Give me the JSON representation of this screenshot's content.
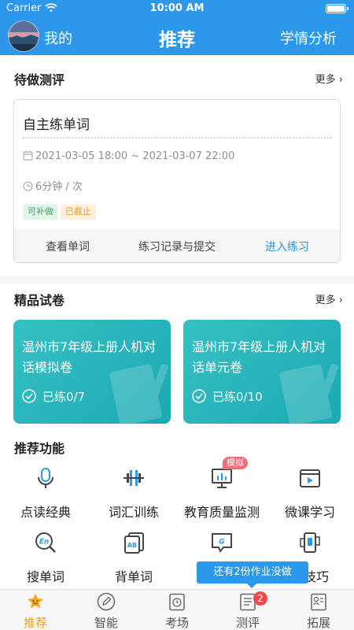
{
  "status_bar": {
    "carrier": "Carrier",
    "time": "10:00 AM"
  },
  "nav": {
    "mine": "我的",
    "title": "推荐",
    "analysis": "学情分析"
  },
  "pending": {
    "heading": "待做测评",
    "more": "更多",
    "card": {
      "title": "自主练单词",
      "date_range": "2021-03-05 18:00 ~ 2021-03-07 22:00",
      "duration": "6分钟 / 次",
      "tags": [
        "可补做",
        "已截止"
      ],
      "actions": [
        "查看单词",
        "练习记录与提交",
        "进入练习"
      ]
    }
  },
  "papers": {
    "heading": "精品试卷",
    "more": "更多",
    "items": [
      {
        "title": "温州市7年级上册人机对话模拟卷",
        "progress": "已练0/7"
      },
      {
        "title": "温州市7年级上册人机对话单元卷",
        "progress": "已练0/10"
      }
    ]
  },
  "functions": {
    "heading": "推荐功能",
    "items": [
      {
        "label": "点读经典",
        "icon": "microphone-icon"
      },
      {
        "label": "词汇训练",
        "icon": "dumbbell-icon"
      },
      {
        "label": "教育质量监测",
        "icon": "monitor-icon",
        "badge": "模拟"
      },
      {
        "label": "微课学习",
        "icon": "video-icon"
      },
      {
        "label": "搜单词",
        "icon": "search-en-icon"
      },
      {
        "label": "背单词",
        "icon": "cards-ab-icon"
      },
      {
        "label": "",
        "icon": "chat-g-icon"
      },
      {
        "label": "文技巧",
        "icon": "phone-card-icon"
      }
    ]
  },
  "toast": "还有2份作业没做",
  "tabbar": {
    "items": [
      {
        "label": "推荐",
        "icon": "star-face-icon",
        "active": true
      },
      {
        "label": "智能",
        "icon": "pencil-circle-icon"
      },
      {
        "label": "考场",
        "icon": "clock-board-icon"
      },
      {
        "label": "测评",
        "icon": "list-doc-icon",
        "badge": "2"
      },
      {
        "label": "拓展",
        "icon": "person-doc-icon"
      }
    ]
  },
  "colors": {
    "primary": "#2b98ec",
    "teal": "#1aa9b2",
    "active_tab": "#ef9b2a",
    "badge_red": "#f04a4a"
  }
}
